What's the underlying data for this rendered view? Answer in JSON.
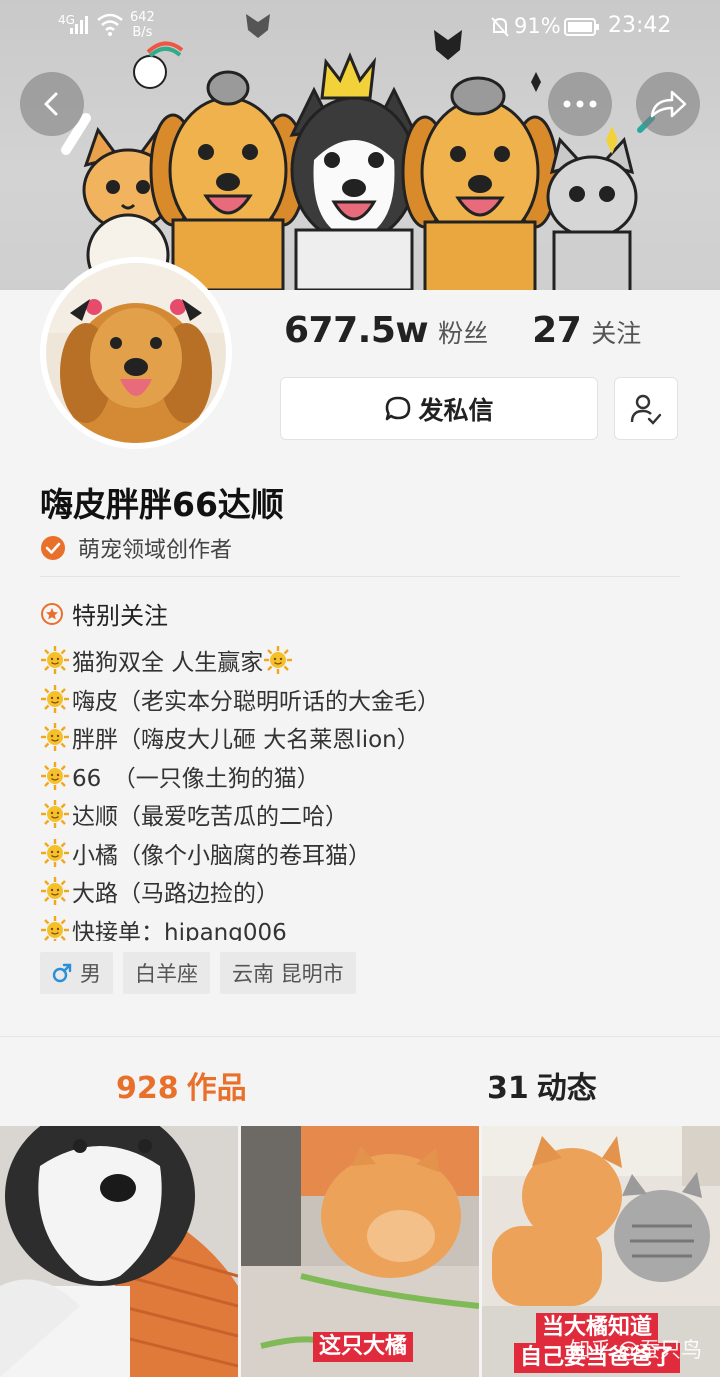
{
  "status_bar": {
    "network": "4G",
    "speed_value": "642",
    "speed_unit": "B/s",
    "battery_percent": "91%",
    "time": "23:42"
  },
  "header": {
    "back_icon": "chevron-left-icon",
    "more_icon": "more-icon",
    "share_icon": "share-icon"
  },
  "profile": {
    "followers_count": "677.5w",
    "followers_label": "粉丝",
    "following_count": "27",
    "following_label": "关注",
    "message_button": "发私信",
    "username": "嗨皮胖胖66达顺",
    "creator_badge": "萌宠领域创作者",
    "special_follow": "特别关注",
    "bio_lines": [
      "猫狗双全 人生赢家",
      "嗨皮（老实本分聪明听话的大金毛）",
      "胖胖（嗨皮大儿砸 大名莱恩lion）",
      "66　（一只像土狗的猫）",
      "达顺（最爱吃苦瓜的二哈）",
      "小橘（像个小脑腐的卷耳猫）",
      "大路（马路边捡的）",
      "快接单：hipang006"
    ],
    "tags": [
      "男",
      "白羊座",
      "云南 昆明市"
    ]
  },
  "tabs": {
    "works_count": "928",
    "works_label": "作品",
    "posts_count": "31",
    "posts_label": "动态"
  },
  "grid": {
    "tile2_caption": "这只大橘",
    "tile3_caption_line1": "当大橘知道",
    "tile3_caption_line2": "自己要当爸爸了"
  },
  "watermark": "知乎 @蚕只鸟",
  "colors": {
    "accent": "#e8702a",
    "caption_red": "#e02b3d"
  }
}
